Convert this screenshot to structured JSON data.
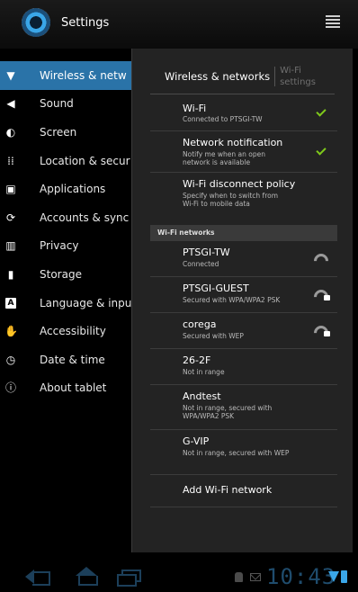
{
  "app": {
    "title": "Settings"
  },
  "headers": [
    {
      "label": "Wireless & netw",
      "icon": "wifi-icon"
    },
    {
      "label": "Sound",
      "icon": "speaker-icon"
    },
    {
      "label": "Screen",
      "icon": "brightness-icon"
    },
    {
      "label": "Location & secur",
      "icon": "grid-icon"
    },
    {
      "label": "Applications",
      "icon": "apps-icon"
    },
    {
      "label": "Accounts & sync",
      "icon": "sync-icon"
    },
    {
      "label": "Privacy",
      "icon": "privacy-icon"
    },
    {
      "label": "Storage",
      "icon": "storage-icon"
    },
    {
      "label": "Language & inpu",
      "icon": "language-icon",
      "glyph": "A"
    },
    {
      "label": "Accessibility",
      "icon": "hand-icon"
    },
    {
      "label": "Date & time",
      "icon": "clock-icon"
    },
    {
      "label": "About tablet",
      "icon": "info-icon"
    }
  ],
  "breadcrumb": {
    "title": "Wireless & networks",
    "subtitle": "Wi-Fi settings"
  },
  "prefs": {
    "wifi": {
      "title": "Wi-Fi",
      "summary": "Connected to PTSGI-TW",
      "checked": true
    },
    "network_notification": {
      "title": "Network notification",
      "summary": "Notify me when an open network is available",
      "checked": true
    },
    "disconnect_policy": {
      "title": "Wi-Fi disconnect policy",
      "summary": "Specify when to switch from Wi-Fi to mobile data"
    }
  },
  "category": {
    "label": "Wi-Fi networks"
  },
  "networks": [
    {
      "ssid": "PTSGI-TW",
      "status": "Connected",
      "icon": "wifi-signal-icon"
    },
    {
      "ssid": "PTSGI-GUEST",
      "status": "Secured with WPA/WPA2 PSK",
      "icon": "wifi-signal-lock-icon"
    },
    {
      "ssid": "corega",
      "status": "Secured with WEP",
      "icon": "wifi-signal-lock-icon"
    },
    {
      "ssid": "26-2F",
      "status": "Not in range"
    },
    {
      "ssid": "Andtest",
      "status": "Not in range, secured with WPA/WPA2 PSK"
    },
    {
      "ssid": "G-VIP",
      "status": "Not in range, secured with WEP"
    }
  ],
  "add_network": {
    "label": "Add Wi-Fi network"
  },
  "status_bar": {
    "time": "10:43"
  },
  "colors": {
    "accent": "#2a73a8",
    "check": "#7fc91b",
    "panel": "#232323"
  }
}
